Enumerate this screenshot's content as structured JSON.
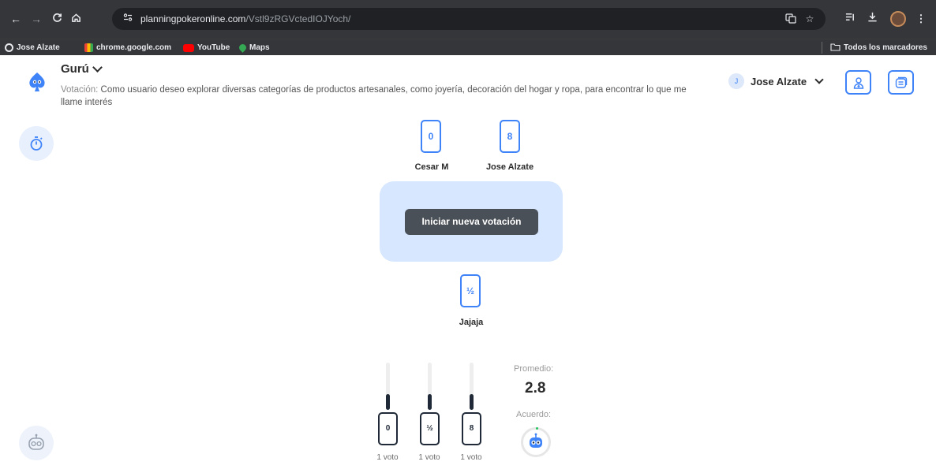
{
  "browser": {
    "url_host": "planningpokeronline.com",
    "url_path": "/Vstl9zRGVctedIOJYoch/",
    "bookmarks": [
      {
        "label": "Jose Alzate",
        "icon": "globe-icon"
      },
      {
        "label": "chrome.google.com",
        "icon": "chrome-webstore-icon"
      },
      {
        "label": "YouTube",
        "icon": "youtube-icon"
      },
      {
        "label": "Maps",
        "icon": "maps-icon"
      }
    ],
    "all_bookmarks_label": "Todos los marcadores"
  },
  "header": {
    "room_name": "Gurú",
    "story_label": "Votación:",
    "story_text": "Como usuario deseo explorar diversas categorías de productos artesanales, como joyería, decoración del hogar y ropa, para encontrar lo que me llame interés",
    "user_initial": "J",
    "user_name": "Jose Alzate"
  },
  "players": [
    {
      "name": "Cesar M",
      "card": "0"
    },
    {
      "name": "Jose Alzate",
      "card": "8"
    },
    {
      "name": "Jajaja",
      "card": "½"
    }
  ],
  "table": {
    "button_label": "Iniciar nueva votación"
  },
  "results": {
    "items": [
      {
        "card": "0",
        "votes_label": "1 voto",
        "votes": 1
      },
      {
        "card": "½",
        "votes_label": "1 voto",
        "votes": 1
      },
      {
        "card": "8",
        "votes_label": "1 voto",
        "votes": 1
      }
    ],
    "average_label": "Promedio:",
    "average_value": "2.8",
    "agreement_label": "Acuerdo:"
  },
  "colors": {
    "accent": "#3f83f8",
    "table_bg": "#d6e7ff",
    "button_bg": "#4a5057"
  }
}
